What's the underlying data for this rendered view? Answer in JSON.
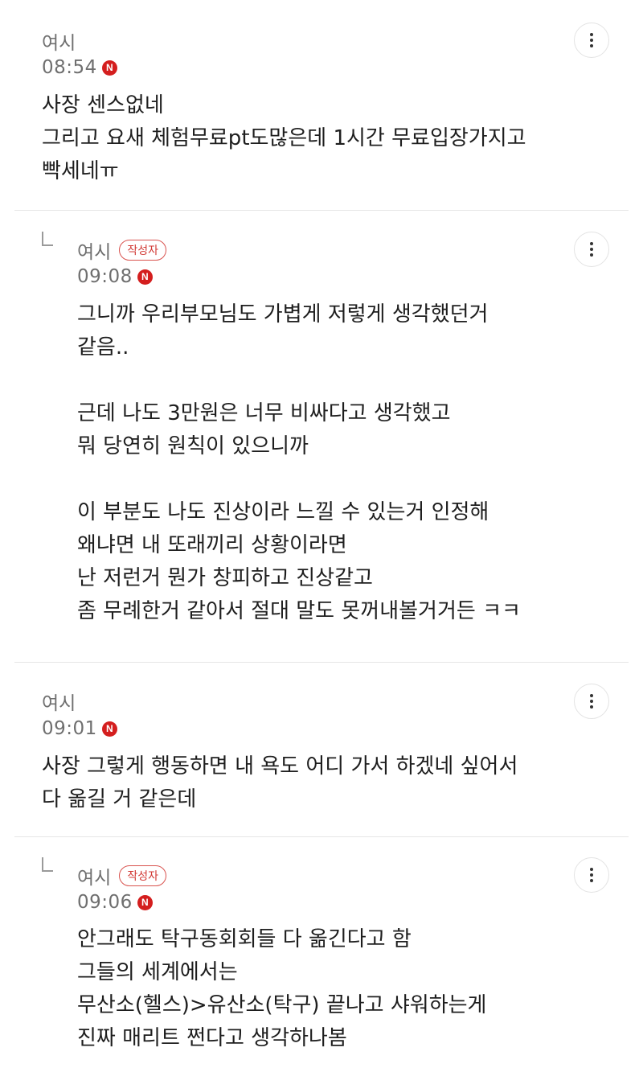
{
  "comments": [
    {
      "author": "여시",
      "time": "08:54",
      "is_author": false,
      "new_label": "N",
      "lines": [
        "사장 센스없네",
        "그리고 요새 체험무료pt도많은데 1시간 무료입장가지고",
        "빡세네ㅠ"
      ]
    },
    {
      "author": "여시",
      "badge": "작성자",
      "time": "09:08",
      "is_author": true,
      "new_label": "N",
      "lines": [
        "그니까 우리부모님도 가볍게 저렇게 생각했던거",
        "같음..",
        "",
        "근데 나도 3만원은 너무 비싸다고 생각했고",
        "뭐 당연히 원칙이 있으니까",
        "",
        "이 부분도 나도 진상이라 느낄 수 있는거 인정해",
        "왜냐면 내 또래끼리 상황이라면",
        "난 저런거 뭔가 창피하고 진상같고",
        "좀 무례한거 같아서 절대 말도 못꺼내볼거거든 ㅋㅋ"
      ]
    },
    {
      "author": "여시",
      "time": "09:01",
      "is_author": false,
      "new_label": "N",
      "lines": [
        "사장 그렇게 행동하면 내 욕도 어디 가서 하겠네 싶어서",
        "다 옮길 거 같은데"
      ]
    },
    {
      "author": "여시",
      "badge": "작성자",
      "time": "09:06",
      "is_author": true,
      "new_label": "N",
      "lines": [
        "안그래도 탁구동회회들 다 옮긴다고 함",
        "그들의 세계에서는",
        "무산소(헬스)>유산소(탁구) 끝나고 샤워하는게",
        "진짜 매리트 쩐다고 생각하나봄"
      ]
    }
  ]
}
